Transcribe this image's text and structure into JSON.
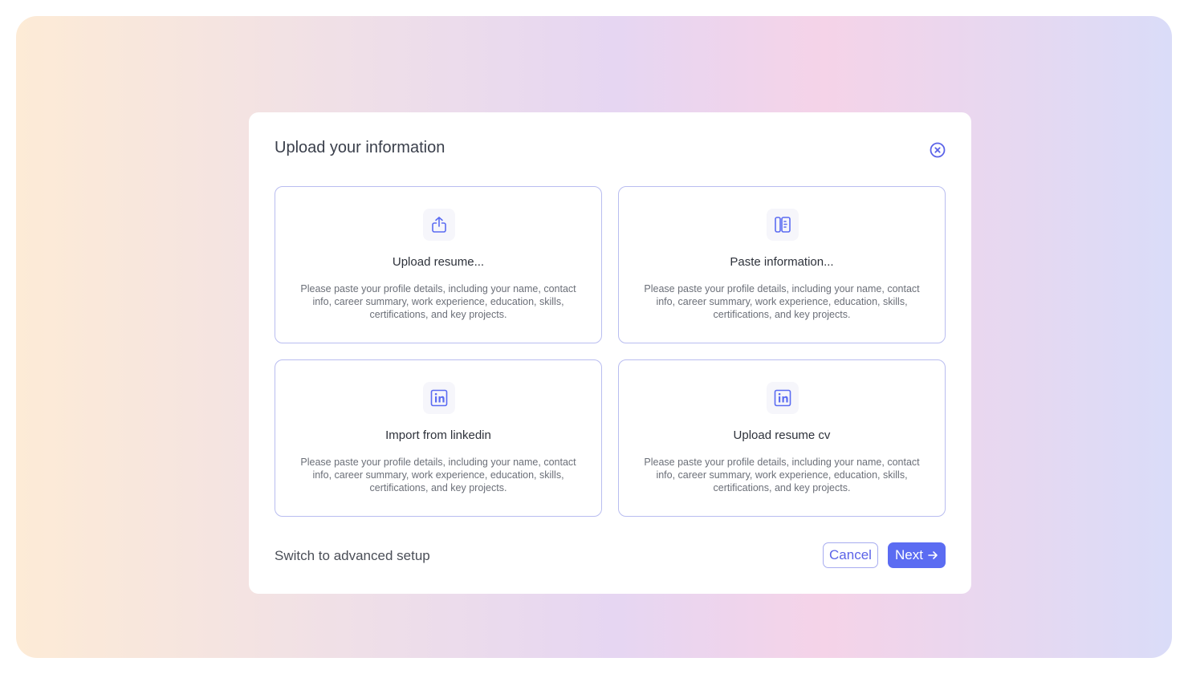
{
  "dialog": {
    "title": "Upload your information",
    "close_icon": "close-circle-icon"
  },
  "options": [
    {
      "title": "Upload resume...",
      "description": "Please paste your profile details, including your name, contact info, career summary, work experience, education, skills, certifications, and key projects.",
      "icon": "upload-icon"
    },
    {
      "title": "Paste information...",
      "description": "Please paste your profile details, including your name, contact info, career summary, work experience, education, skills, certifications, and key projects.",
      "icon": "paste-document-icon"
    },
    {
      "title": "Import from linkedin",
      "description": "Please paste your profile details, including your name, contact info, career summary, work experience, education, skills, certifications, and key projects.",
      "icon": "linkedin-icon"
    },
    {
      "title": "Upload resume cv",
      "description": "Please paste your profile details, including your name, contact info, career summary, work experience, education, skills, certifications, and key projects.",
      "icon": "linkedin-icon"
    }
  ],
  "footer": {
    "advanced_link": "Switch to advanced setup",
    "cancel_label": "Cancel",
    "next_label": "Next",
    "next_icon": "arrow-right-icon"
  },
  "colors": {
    "accent": "#5b6cf2",
    "card_border": "#b9bdf0"
  }
}
